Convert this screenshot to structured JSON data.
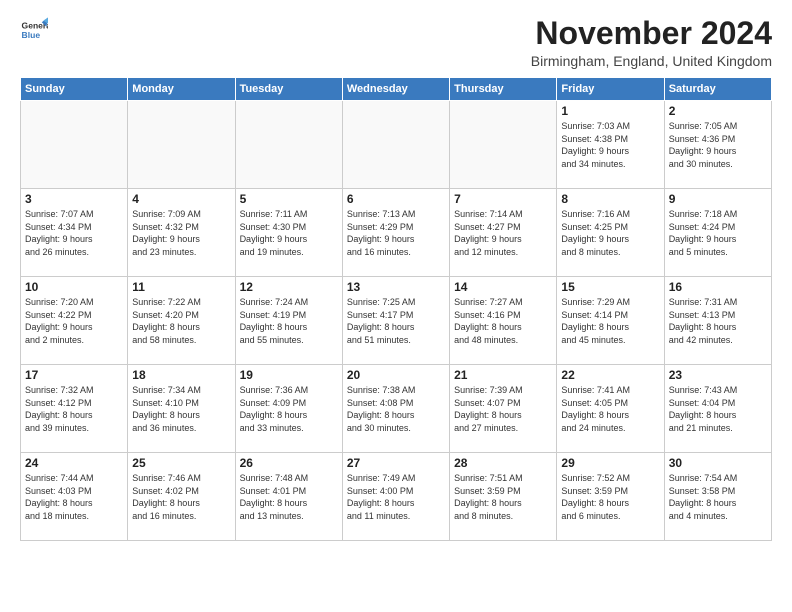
{
  "header": {
    "logo_line1": "General",
    "logo_line2": "Blue",
    "month_title": "November 2024",
    "location": "Birmingham, England, United Kingdom"
  },
  "weekdays": [
    "Sunday",
    "Monday",
    "Tuesday",
    "Wednesday",
    "Thursday",
    "Friday",
    "Saturday"
  ],
  "weeks": [
    [
      {
        "day": "",
        "info": ""
      },
      {
        "day": "",
        "info": ""
      },
      {
        "day": "",
        "info": ""
      },
      {
        "day": "",
        "info": ""
      },
      {
        "day": "",
        "info": ""
      },
      {
        "day": "1",
        "info": "Sunrise: 7:03 AM\nSunset: 4:38 PM\nDaylight: 9 hours\nand 34 minutes."
      },
      {
        "day": "2",
        "info": "Sunrise: 7:05 AM\nSunset: 4:36 PM\nDaylight: 9 hours\nand 30 minutes."
      }
    ],
    [
      {
        "day": "3",
        "info": "Sunrise: 7:07 AM\nSunset: 4:34 PM\nDaylight: 9 hours\nand 26 minutes."
      },
      {
        "day": "4",
        "info": "Sunrise: 7:09 AM\nSunset: 4:32 PM\nDaylight: 9 hours\nand 23 minutes."
      },
      {
        "day": "5",
        "info": "Sunrise: 7:11 AM\nSunset: 4:30 PM\nDaylight: 9 hours\nand 19 minutes."
      },
      {
        "day": "6",
        "info": "Sunrise: 7:13 AM\nSunset: 4:29 PM\nDaylight: 9 hours\nand 16 minutes."
      },
      {
        "day": "7",
        "info": "Sunrise: 7:14 AM\nSunset: 4:27 PM\nDaylight: 9 hours\nand 12 minutes."
      },
      {
        "day": "8",
        "info": "Sunrise: 7:16 AM\nSunset: 4:25 PM\nDaylight: 9 hours\nand 8 minutes."
      },
      {
        "day": "9",
        "info": "Sunrise: 7:18 AM\nSunset: 4:24 PM\nDaylight: 9 hours\nand 5 minutes."
      }
    ],
    [
      {
        "day": "10",
        "info": "Sunrise: 7:20 AM\nSunset: 4:22 PM\nDaylight: 9 hours\nand 2 minutes."
      },
      {
        "day": "11",
        "info": "Sunrise: 7:22 AM\nSunset: 4:20 PM\nDaylight: 8 hours\nand 58 minutes."
      },
      {
        "day": "12",
        "info": "Sunrise: 7:24 AM\nSunset: 4:19 PM\nDaylight: 8 hours\nand 55 minutes."
      },
      {
        "day": "13",
        "info": "Sunrise: 7:25 AM\nSunset: 4:17 PM\nDaylight: 8 hours\nand 51 minutes."
      },
      {
        "day": "14",
        "info": "Sunrise: 7:27 AM\nSunset: 4:16 PM\nDaylight: 8 hours\nand 48 minutes."
      },
      {
        "day": "15",
        "info": "Sunrise: 7:29 AM\nSunset: 4:14 PM\nDaylight: 8 hours\nand 45 minutes."
      },
      {
        "day": "16",
        "info": "Sunrise: 7:31 AM\nSunset: 4:13 PM\nDaylight: 8 hours\nand 42 minutes."
      }
    ],
    [
      {
        "day": "17",
        "info": "Sunrise: 7:32 AM\nSunset: 4:12 PM\nDaylight: 8 hours\nand 39 minutes."
      },
      {
        "day": "18",
        "info": "Sunrise: 7:34 AM\nSunset: 4:10 PM\nDaylight: 8 hours\nand 36 minutes."
      },
      {
        "day": "19",
        "info": "Sunrise: 7:36 AM\nSunset: 4:09 PM\nDaylight: 8 hours\nand 33 minutes."
      },
      {
        "day": "20",
        "info": "Sunrise: 7:38 AM\nSunset: 4:08 PM\nDaylight: 8 hours\nand 30 minutes."
      },
      {
        "day": "21",
        "info": "Sunrise: 7:39 AM\nSunset: 4:07 PM\nDaylight: 8 hours\nand 27 minutes."
      },
      {
        "day": "22",
        "info": "Sunrise: 7:41 AM\nSunset: 4:05 PM\nDaylight: 8 hours\nand 24 minutes."
      },
      {
        "day": "23",
        "info": "Sunrise: 7:43 AM\nSunset: 4:04 PM\nDaylight: 8 hours\nand 21 minutes."
      }
    ],
    [
      {
        "day": "24",
        "info": "Sunrise: 7:44 AM\nSunset: 4:03 PM\nDaylight: 8 hours\nand 18 minutes."
      },
      {
        "day": "25",
        "info": "Sunrise: 7:46 AM\nSunset: 4:02 PM\nDaylight: 8 hours\nand 16 minutes."
      },
      {
        "day": "26",
        "info": "Sunrise: 7:48 AM\nSunset: 4:01 PM\nDaylight: 8 hours\nand 13 minutes."
      },
      {
        "day": "27",
        "info": "Sunrise: 7:49 AM\nSunset: 4:00 PM\nDaylight: 8 hours\nand 11 minutes."
      },
      {
        "day": "28",
        "info": "Sunrise: 7:51 AM\nSunset: 3:59 PM\nDaylight: 8 hours\nand 8 minutes."
      },
      {
        "day": "29",
        "info": "Sunrise: 7:52 AM\nSunset: 3:59 PM\nDaylight: 8 hours\nand 6 minutes."
      },
      {
        "day": "30",
        "info": "Sunrise: 7:54 AM\nSunset: 3:58 PM\nDaylight: 8 hours\nand 4 minutes."
      }
    ]
  ]
}
